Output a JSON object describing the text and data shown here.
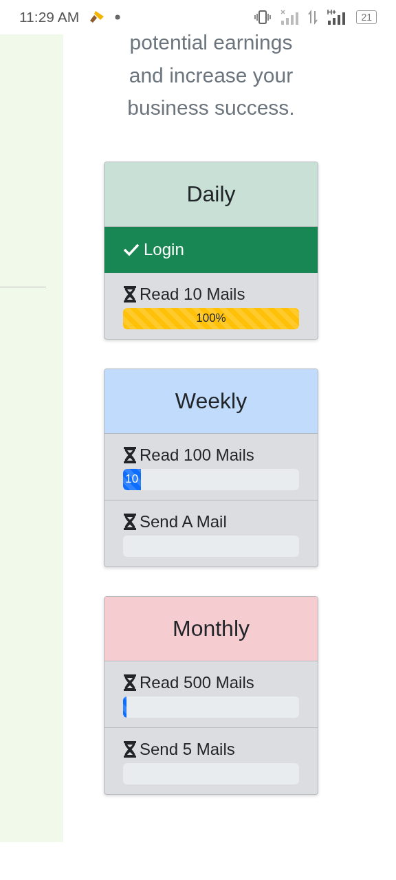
{
  "status_bar": {
    "time": "11:29 AM",
    "battery": "21"
  },
  "intro": [
    "potential earnings",
    "and increase your",
    "business success."
  ],
  "cards": [
    {
      "title": "Daily",
      "color": "#c8e0d6",
      "tasks": [
        {
          "kind": "done",
          "label": "Login"
        },
        {
          "kind": "progress",
          "label": "Read 10 Mails",
          "level": 1,
          "reading": "100%",
          "color": "#ffc107"
        }
      ]
    },
    {
      "title": "Weekly",
      "color": "#c0dbfb",
      "tasks": [
        {
          "kind": "progress",
          "label": "Read 100 Mails",
          "level": 0.1,
          "reading": "10",
          "color": "#0d6efd"
        },
        {
          "kind": "progress",
          "label": "Send A Mail"
        }
      ]
    },
    {
      "title": "Monthly",
      "color": "#f5cdd0",
      "tasks": [
        {
          "kind": "progress",
          "label": "Read 500 Mails",
          "level": 0.02,
          "color": "#0d6efd"
        },
        {
          "kind": "progress",
          "label": "Send 5 Mails"
        }
      ]
    }
  ]
}
